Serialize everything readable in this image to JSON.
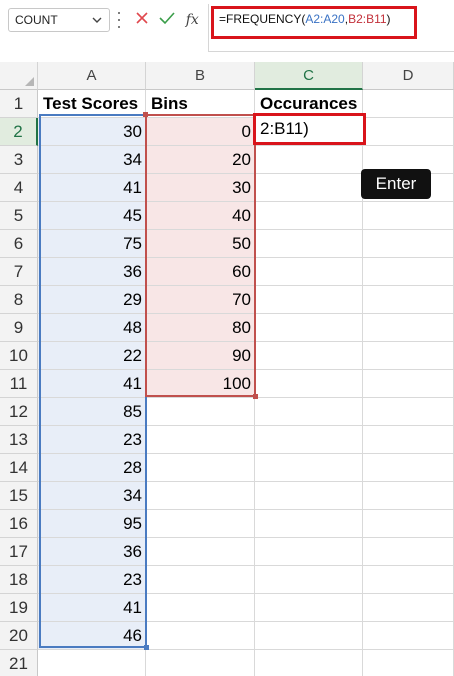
{
  "name_box": {
    "value": "COUNT",
    "chevron_icon": "chevron-down-icon"
  },
  "formula_bar": {
    "icons": [
      "cancel-x-icon",
      "confirm-check-icon",
      "fx-icon"
    ],
    "fx_label": "fx",
    "prefix": "=FREQUENCY(",
    "ref_a": "A2:A20",
    "separator": ",",
    "ref_b": "B2:B11",
    "suffix": ")",
    "highlight_color": "#d9141b",
    "ref_a_color": "#3a72c4",
    "ref_b_color": "#c2303a"
  },
  "columns": [
    "A",
    "B",
    "C",
    "D"
  ],
  "active_column": "C",
  "active_row": "2",
  "rows": [
    "1",
    "2",
    "3",
    "4",
    "5",
    "6",
    "7",
    "8",
    "9",
    "10",
    "11",
    "12",
    "13",
    "14",
    "15",
    "16",
    "17",
    "18",
    "19",
    "20",
    "21"
  ],
  "headers": {
    "a": "Test Scores",
    "b": "Bins",
    "c": "Occurances"
  },
  "test_scores": [
    "30",
    "34",
    "41",
    "45",
    "75",
    "36",
    "29",
    "48",
    "22",
    "41",
    "85",
    "23",
    "28",
    "34",
    "95",
    "36",
    "23",
    "41",
    "46"
  ],
  "bins": [
    "0",
    "20",
    "30",
    "40",
    "50",
    "60",
    "70",
    "80",
    "90",
    "100"
  ],
  "active_cell_text": "2:B11)",
  "enter_badge": "Enter",
  "colors": {
    "accent_green": "#217346",
    "range_a": "#4a7bc1",
    "range_b": "#c0504d",
    "highlight_red": "#d9141b"
  }
}
